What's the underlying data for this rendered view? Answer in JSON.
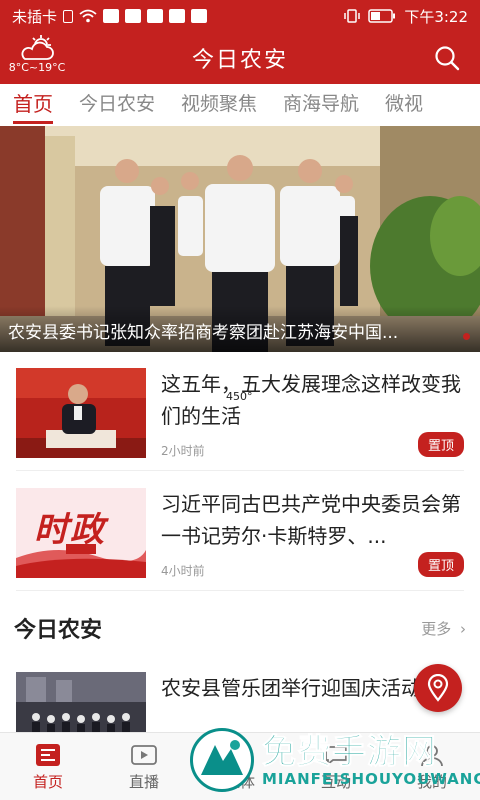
{
  "status_bar": {
    "carrier": "未插卡",
    "time": "下午3:22"
  },
  "header": {
    "weather_temp": "8°C~19°C",
    "title": "今日农安"
  },
  "tabs": [
    "首页",
    "今日农安",
    "视频聚焦",
    "商海导航",
    "微视"
  ],
  "hero": {
    "caption": "农安县委书记张知众率招商考察团赴江苏海安中国..."
  },
  "news": [
    {
      "title": "这五年，五大发展理念这样改变我们的生活",
      "time": "2小时前",
      "badge": "置顶"
    },
    {
      "title": "习近平同古巴共产党中央委员会第一书记劳尔·卡斯特罗、...",
      "time": "4小时前",
      "badge": "置顶",
      "thumb_text": "时政"
    }
  ],
  "overlay_number": "450°",
  "section": {
    "title": "今日农安",
    "more": "更多"
  },
  "section_news": [
    {
      "title": "农安县管乐团举行迎国庆活动义演"
    }
  ],
  "bottom_nav": [
    "首页",
    "直播",
    "媒体",
    "互动",
    "我的"
  ],
  "watermark": {
    "main": "免费手游网",
    "sub": "MIANFEISHOUYOUWANG"
  },
  "colors": {
    "brand": "#c4211f",
    "watermark": "#1aa39a"
  }
}
